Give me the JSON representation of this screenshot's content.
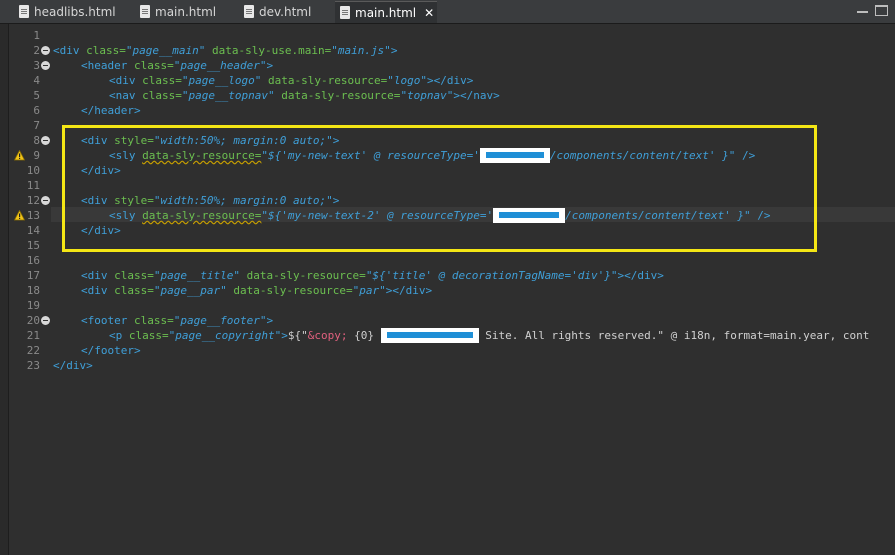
{
  "tabs": [
    {
      "label": "headlibs.html",
      "active": false
    },
    {
      "label": "main.html",
      "active": false
    },
    {
      "label": "dev.html",
      "active": false
    },
    {
      "label": "main.html",
      "active": true
    }
  ],
  "close_glyph": "✕",
  "line_numbers": [
    "1",
    "2",
    "3",
    "4",
    "5",
    "6",
    "7",
    "8",
    "9",
    "10",
    "11",
    "12",
    "13",
    "14",
    "15",
    "16",
    "17",
    "18",
    "19",
    "20",
    "21",
    "22",
    "23"
  ],
  "code": {
    "l2": {
      "open": "<div",
      "a1": "class=",
      "v1": "\"page__main\"",
      "a2": "data-sly-use.main=",
      "v2": "\"main.js\"",
      "close": ">"
    },
    "l3": {
      "open": "<header",
      "a1": "class=",
      "v1": "\"page__header\"",
      "close": ">"
    },
    "l4": {
      "open": "<div",
      "a1": "class=",
      "v1": "\"page__logo\"",
      "a2": "data-sly-resource=",
      "v2": "\"logo\"",
      "close": "></div>"
    },
    "l5": {
      "open": "<nav",
      "a1": "class=",
      "v1": "\"page__topnav\"",
      "a2": "data-sly-resource=",
      "v2": "\"topnav\"",
      "close": "></nav>"
    },
    "l6": {
      "close": "</header>"
    },
    "l8": {
      "open": "<div",
      "a1": "style=",
      "v1a": "\"width:50%;",
      "v1b": "margin:0 auto;\"",
      "close": ">"
    },
    "l9": {
      "open": "<sly",
      "a1": "data-sly-resource=",
      "v1": "\"${'my-new-text' @ resourceType='",
      "v2": "/components/content/text' }\"",
      "close": "/>"
    },
    "l10": {
      "close": "</div>"
    },
    "l12": {
      "open": "<div",
      "a1": "style=",
      "v1a": "\"width:50%;",
      "v1b": "margin:0 auto;\"",
      "close": ">"
    },
    "l13": {
      "open": "<sly",
      "a1": "data-sly-resource=",
      "v1": "\"${'my-new-text-2' @ resourceType='",
      "v2": "/components/content/text' }\"",
      "close": "/>"
    },
    "l14": {
      "close": "</div>"
    },
    "l17": {
      "open": "<div",
      "a1": "class=",
      "v1": "\"page__title\"",
      "a2": "data-sly-resource=",
      "v2": "\"${'title' @ decorationTagName='div'}\"",
      "close": "></div>"
    },
    "l18": {
      "open": "<div",
      "a1": "class=",
      "v1": "\"page__par\"",
      "a2": "data-sly-resource=",
      "v2": "\"par\"",
      "close": "></div>"
    },
    "l20": {
      "open": "<footer",
      "a1": "class=",
      "v1": "\"page__footer\"",
      "close": ">"
    },
    "l21": {
      "open": "<p",
      "a1": "class=",
      "v1": "\"page__copyright\"",
      "close": ">",
      "t1": "${\"",
      "ent": "&copy;",
      "t2": " {0} ",
      "t3": " Site. All rights reserved.\" @ i18n, format=main.year, cont"
    },
    "l22": {
      "close": "</footer>"
    },
    "l23": {
      "close": "</div>"
    }
  },
  "colors": {
    "tag": "#3f9fd8",
    "attr": "#6cbf50",
    "entity": "#e0607e",
    "highlight_box": "#f4e615",
    "redaction_bar": "#1f8fd6"
  },
  "icons": [
    "file-icon",
    "close-icon",
    "warning-icon",
    "fold-icon",
    "minimize-icon",
    "maximize-icon"
  ]
}
